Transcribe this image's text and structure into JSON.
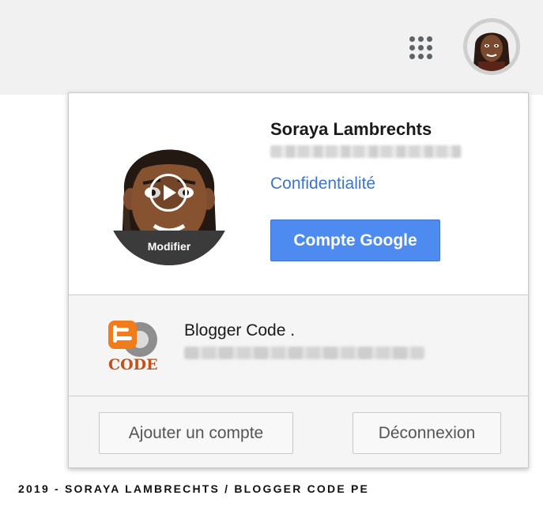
{
  "user": {
    "name": "Soraya Lambrechts",
    "modify_label": "Modifier",
    "privacy_link": "Confidentialité",
    "google_account_button": "Compte Google"
  },
  "other_account": {
    "name": "Blogger Code ."
  },
  "footer": {
    "add_account_button": "Ajouter un compte",
    "logout_button": "Déconnexion"
  },
  "credit": "2019 - SORAYA LAMBRECHTS / BLOGGER CODE PE",
  "icons": {
    "apps": "apps-grid-icon",
    "avatar": "avatar-icon",
    "play": "play-icon",
    "blogger": "blogger-logo"
  },
  "colors": {
    "accent": "#4d8bf0",
    "link": "#3e74c9",
    "topbar": "#f1f1f1"
  }
}
